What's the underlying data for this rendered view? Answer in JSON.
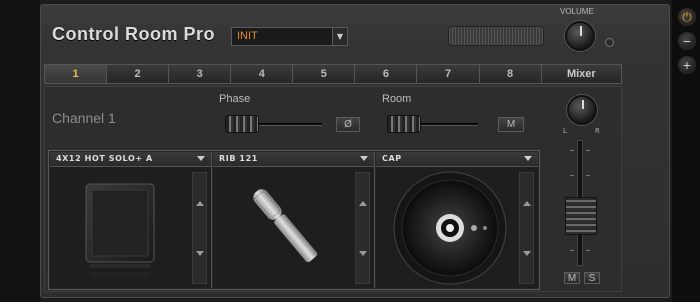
{
  "header": {
    "title": "Control Room Pro",
    "preset_value": "INIT",
    "volume_label": "VOLUME",
    "volume_led": "L"
  },
  "tabs": [
    "1",
    "2",
    "3",
    "4",
    "5",
    "6",
    "7",
    "8",
    "Mixer"
  ],
  "active_tab": "1",
  "channel": {
    "label": "Channel 1",
    "phase_label": "Phase",
    "phase_button": "Ø",
    "room_label": "Room",
    "room_button": "M"
  },
  "slots": [
    {
      "name": "4X12 HOT SOLO+ A"
    },
    {
      "name": "RIB 121"
    },
    {
      "name": "CAP"
    }
  ],
  "mixer": {
    "knob_left": "L",
    "knob_right": "R",
    "mute": "M",
    "solo": "S"
  },
  "colors": {
    "accent_active_tab": "#e8c24a",
    "preset_text": "#e08a2a",
    "power_icon": "#e8a020"
  }
}
